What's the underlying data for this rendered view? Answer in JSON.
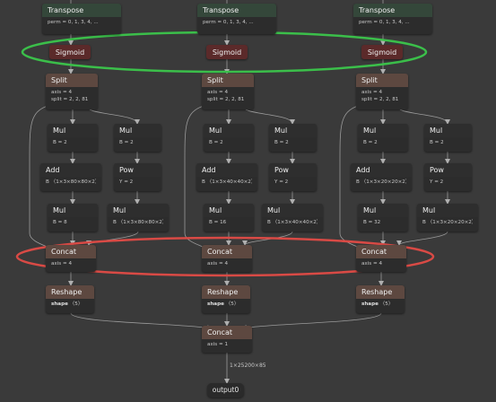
{
  "colors": {
    "background": "#3a3a3a",
    "edge": "#9a9a9a",
    "highlight_sigmoid": "#3bbf4a",
    "highlight_concat": "#d94a45"
  },
  "branches": [
    {
      "transpose": {
        "title": "Transpose",
        "attr": "perm = 0, 1, 3, 4, ..."
      },
      "sigmoid": {
        "title": "Sigmoid"
      },
      "split": {
        "title": "Split",
        "attrs": [
          "axis = 4",
          "split = 2, 2, 81"
        ]
      },
      "mul_a": {
        "title": "Mul",
        "attr": "B = 2"
      },
      "mul_b": {
        "title": "Mul",
        "attr": "B = 2"
      },
      "add": {
        "title": "Add",
        "attr": "B 〈1×3×80×80×2〉"
      },
      "pow": {
        "title": "Pow",
        "attr": "Y = 2"
      },
      "mul_c": {
        "title": "Mul",
        "attr": "B = 8"
      },
      "mul_d": {
        "title": "Mul",
        "attr": "B 〈1×3×80×80×2〉"
      },
      "concat": {
        "title": "Concat",
        "attr": "axis = 4"
      },
      "reshape": {
        "title": "Reshape",
        "attr_key": "shape",
        "attr_val": "〈5〉"
      }
    },
    {
      "transpose": {
        "title": "Transpose",
        "attr": "perm = 0, 1, 3, 4, ..."
      },
      "sigmoid": {
        "title": "Sigmoid"
      },
      "split": {
        "title": "Split",
        "attrs": [
          "axis = 4",
          "split = 2, 2, 81"
        ]
      },
      "mul_a": {
        "title": "Mul",
        "attr": "B = 2"
      },
      "mul_b": {
        "title": "Mul",
        "attr": "B = 2"
      },
      "add": {
        "title": "Add",
        "attr": "B 〈1×3×40×40×2〉"
      },
      "pow": {
        "title": "Pow",
        "attr": "Y = 2"
      },
      "mul_c": {
        "title": "Mul",
        "attr": "B = 16"
      },
      "mul_d": {
        "title": "Mul",
        "attr": "B 〈1×3×40×40×2〉"
      },
      "concat": {
        "title": "Concat",
        "attr": "axis = 4"
      },
      "reshape": {
        "title": "Reshape",
        "attr_key": "shape",
        "attr_val": "〈5〉"
      }
    },
    {
      "transpose": {
        "title": "Transpose",
        "attr": "perm = 0, 1, 3, 4, ..."
      },
      "sigmoid": {
        "title": "Sigmoid"
      },
      "split": {
        "title": "Split",
        "attrs": [
          "axis = 4",
          "split = 2, 2, 81"
        ]
      },
      "mul_a": {
        "title": "Mul",
        "attr": "B = 2"
      },
      "mul_b": {
        "title": "Mul",
        "attr": "B = 2"
      },
      "add": {
        "title": "Add",
        "attr": "B 〈1×3×20×20×2〉"
      },
      "pow": {
        "title": "Pow",
        "attr": "Y = 2"
      },
      "mul_c": {
        "title": "Mul",
        "attr": "B = 32"
      },
      "mul_d": {
        "title": "Mul",
        "attr": "B 〈1×3×20×20×2〉"
      },
      "concat": {
        "title": "Concat",
        "attr": "axis = 4"
      },
      "reshape": {
        "title": "Reshape",
        "attr_key": "shape",
        "attr_val": "〈5〉"
      }
    }
  ],
  "final_concat": {
    "title": "Concat",
    "attr": "axis = 1"
  },
  "output_edge_label": "1×25200×85",
  "output": {
    "label": "output0"
  }
}
